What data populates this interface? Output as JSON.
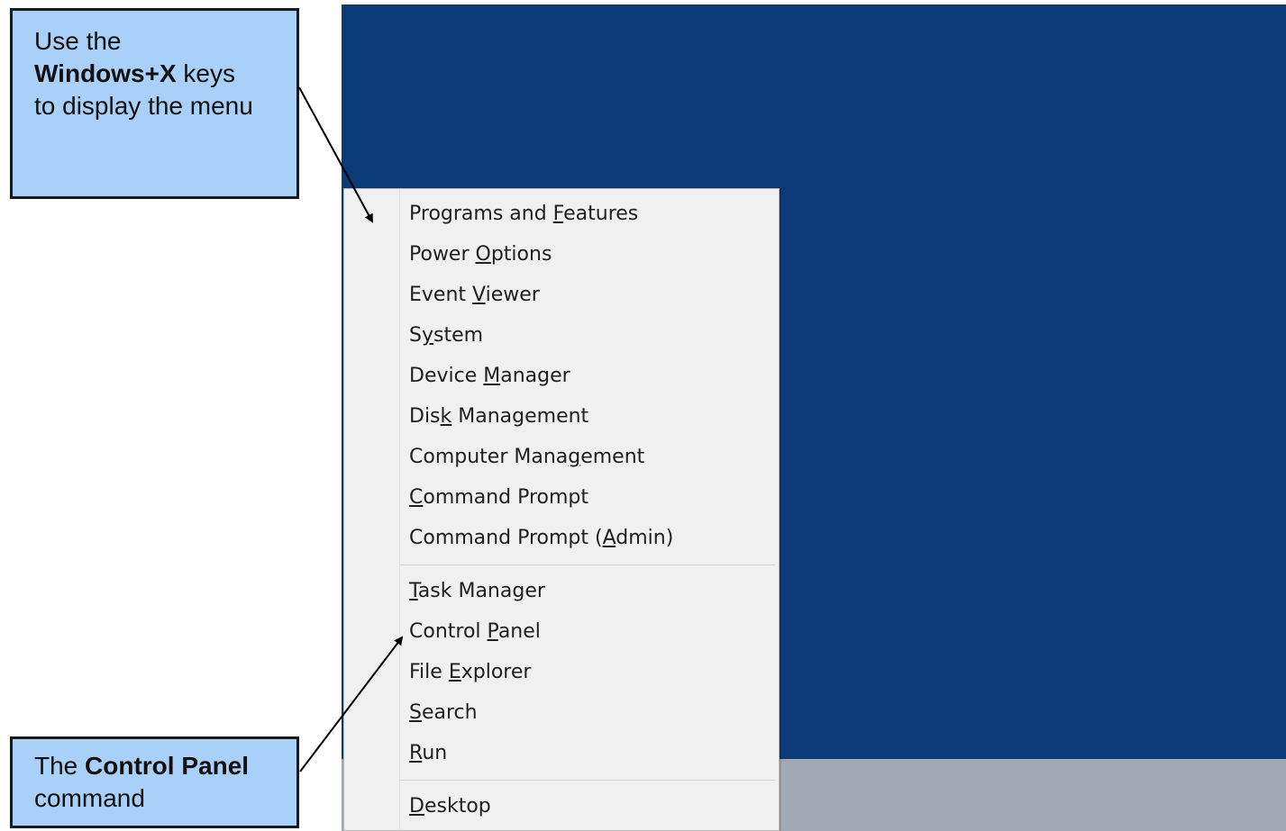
{
  "callouts": {
    "top": {
      "line1": "Use the",
      "line2_bold": "Windows+X",
      "line2_rest": " keys",
      "line3": "to display the menu"
    },
    "bottom": {
      "line1_prefix": "The ",
      "line1_bold": "Control Panel",
      "line2": "command"
    }
  },
  "menu": {
    "group1": [
      {
        "label": "Programs and Features",
        "access_key": "F"
      },
      {
        "label": "Power Options",
        "access_key": "O"
      },
      {
        "label": "Event Viewer",
        "access_key": "V"
      },
      {
        "label": "System",
        "access_key": "y"
      },
      {
        "label": "Device Manager",
        "access_key": "M"
      },
      {
        "label": "Disk Management",
        "access_key": "k"
      },
      {
        "label": "Computer Management",
        "access_key": "g"
      },
      {
        "label": "Command Prompt",
        "access_key": "C"
      },
      {
        "label": "Command Prompt (Admin)",
        "access_key": "A"
      }
    ],
    "group2": [
      {
        "label": "Task Manager",
        "access_key": "T"
      },
      {
        "label": "Control Panel",
        "access_key": "P"
      },
      {
        "label": "File Explorer",
        "access_key": "E"
      },
      {
        "label": "Search",
        "access_key": "S"
      },
      {
        "label": "Run",
        "access_key": "R"
      }
    ],
    "group3": [
      {
        "label": "Desktop",
        "access_key": "D"
      }
    ]
  },
  "colors": {
    "desktop": "#0b3a78",
    "taskbar": "#a3a9b3",
    "menu_bg": "#f0f0f0",
    "callout_bg": "#a8d0f8"
  }
}
